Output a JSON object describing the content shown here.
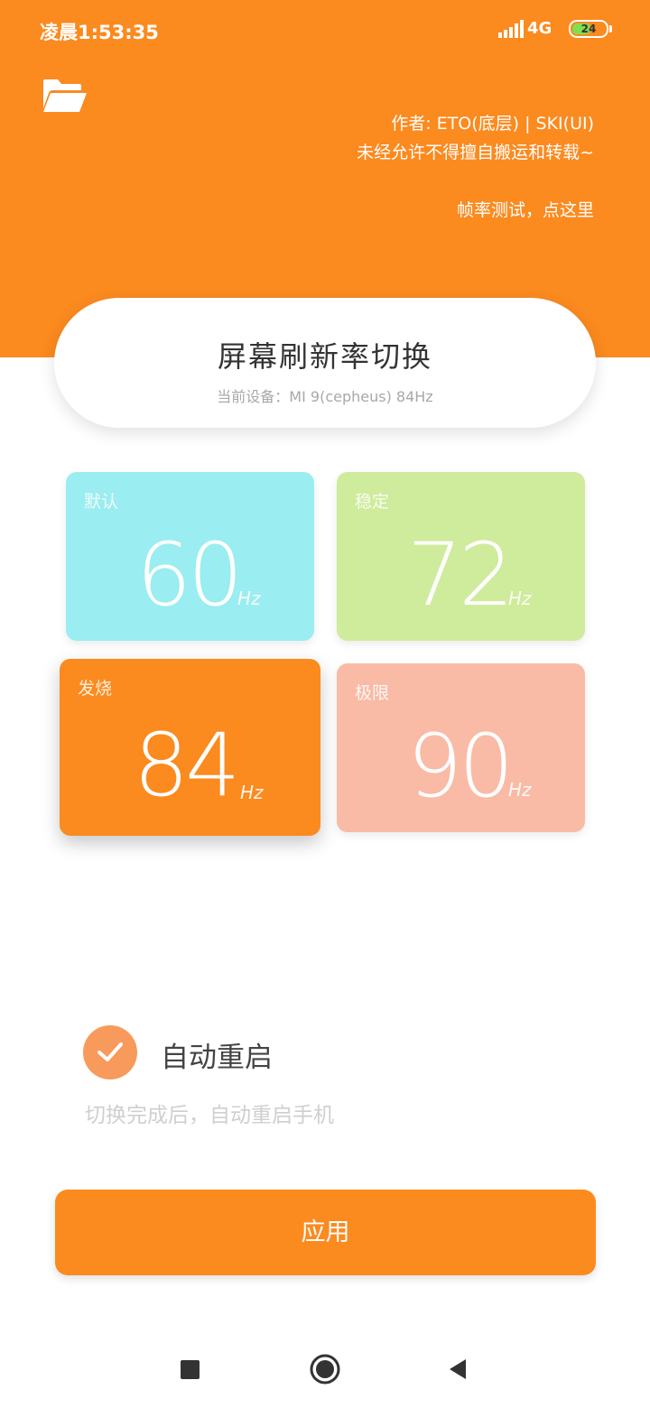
{
  "status_bar": {
    "time": "凌晨1:53:35",
    "network": "4G",
    "battery": "24"
  },
  "header": {
    "author": "作者: ETO(底层) | SKI(UI)",
    "notice": "未经允许不得擅自搬运和转载~",
    "fps_test": "帧率测试，点这里"
  },
  "title_card": {
    "title": "屏幕刷新率切换",
    "device": "当前设备：MI 9(cepheus) 84Hz"
  },
  "rates": [
    {
      "label": "默认",
      "value": "60",
      "unit": "Hz",
      "color": "#9aedf0"
    },
    {
      "label": "稳定",
      "value": "72",
      "unit": "Hz",
      "color": "#cfeb9c"
    },
    {
      "label": "发烧",
      "value": "84",
      "unit": "Hz",
      "color": "#fb8a1f",
      "selected": true
    },
    {
      "label": "极限",
      "value": "90",
      "unit": "Hz",
      "color": "#f9bba6"
    }
  ],
  "auto_restart": {
    "label": "自动重启",
    "description": "切换完成后，自动重启手机",
    "checked": true
  },
  "apply_button": "应用",
  "colors": {
    "accent": "#fb8a1f"
  }
}
